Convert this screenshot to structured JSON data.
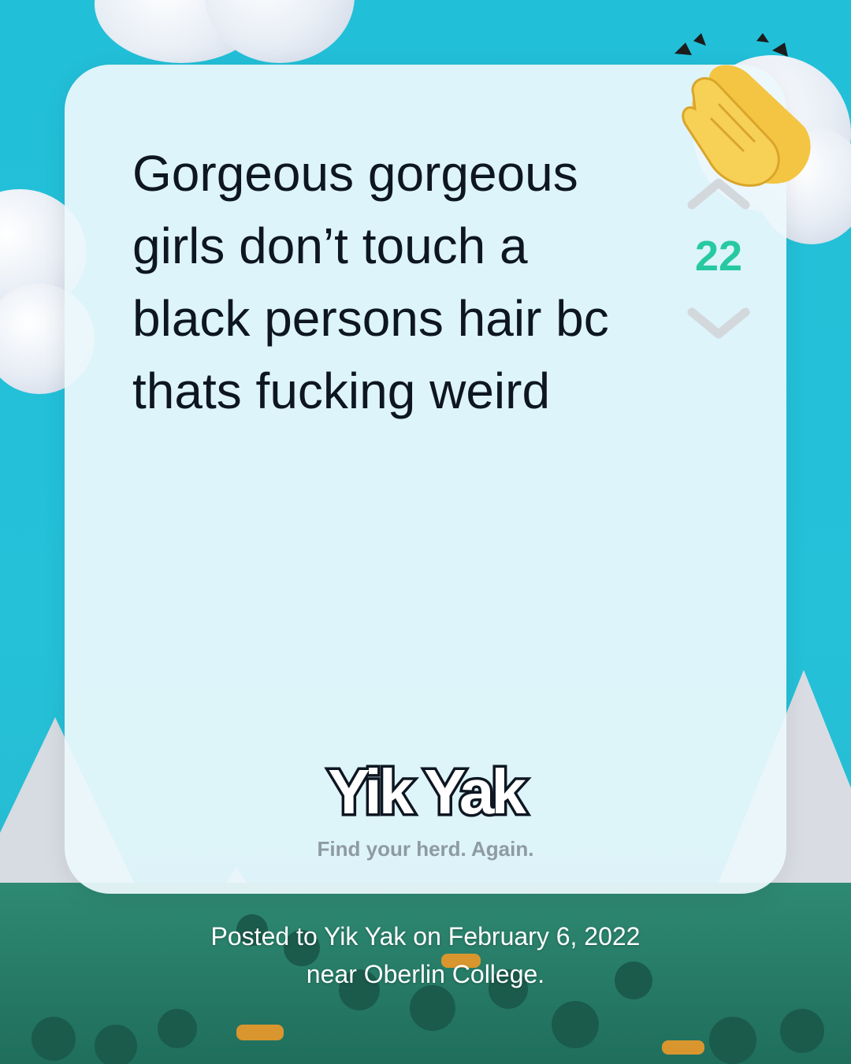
{
  "post": {
    "text": "Gorgeous gorgeous girls don’t touch a black persons hair bc thats fucking weird",
    "votes": "22"
  },
  "brand": {
    "logo_text": "Yik Yak",
    "tagline": "Find your herd. Again."
  },
  "caption": {
    "text": "Posted to Yik Yak on February 6, 2022 near Oberlin College."
  },
  "icons": {
    "upvote": "chevron-up-icon",
    "downvote": "chevron-down-icon",
    "clap": "clapping-hands-icon"
  },
  "colors": {
    "background": "#22bfd8",
    "card": "#ecf7fc",
    "vote_count": "#27c9a3",
    "post_text": "#0d1621",
    "tagline": "#8f9aa3"
  }
}
